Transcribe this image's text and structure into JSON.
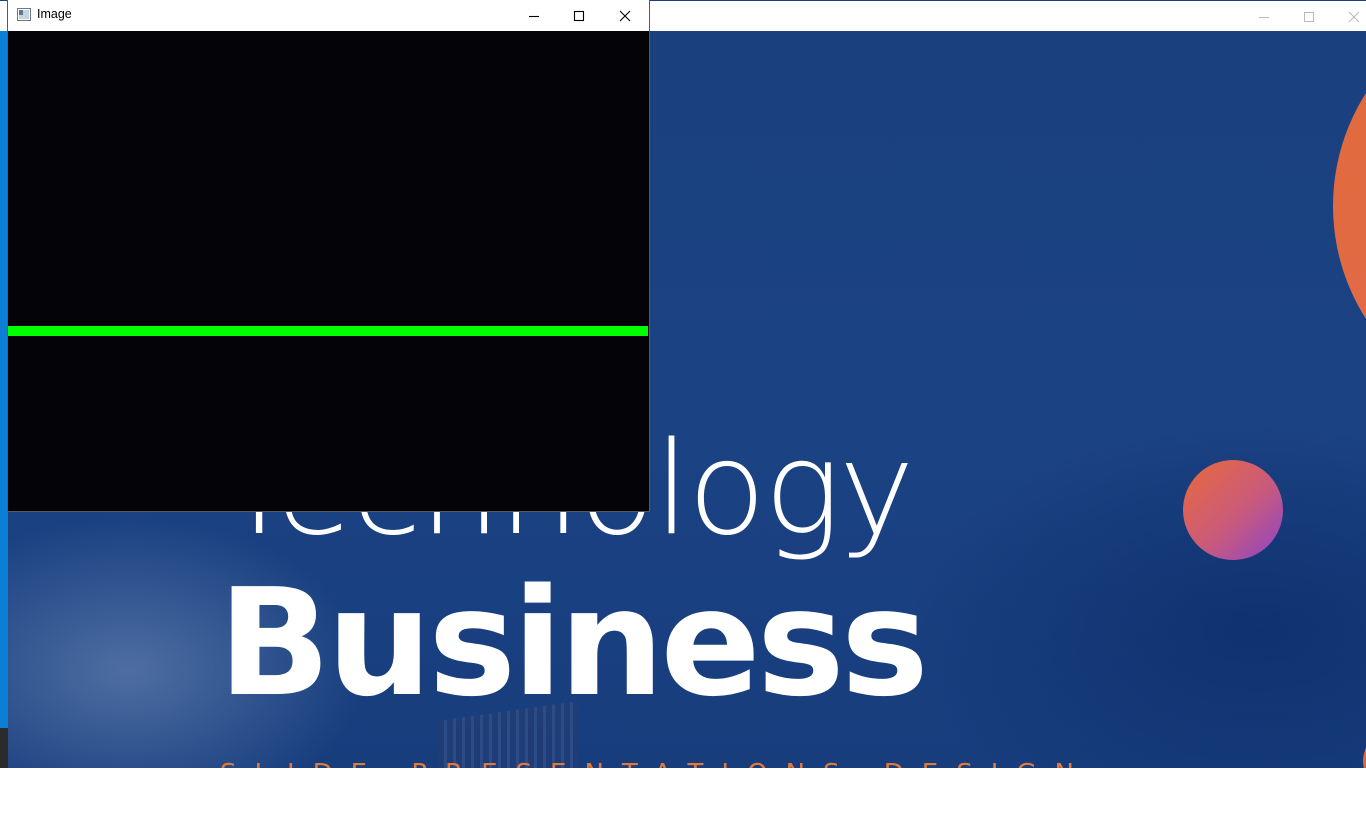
{
  "background_window": {
    "slide": {
      "line1": "Technology",
      "line2": "Business",
      "subtitle": "SLIDE PRESENTATIONS DESIGN",
      "colors": {
        "background": "#1b3f7c",
        "accent": "#e07a3a",
        "text": "#ffffff"
      }
    },
    "controls": {
      "minimize_icon": "minimize-icon",
      "maximize_icon": "maximize-icon",
      "close_icon": "close-icon"
    }
  },
  "image_window": {
    "title": "Image",
    "controls": {
      "minimize_icon": "minimize-icon",
      "maximize_icon": "maximize-icon",
      "close_icon": "close-icon"
    },
    "canvas": {
      "background": "#040307",
      "line_color": "#00ff00"
    }
  }
}
